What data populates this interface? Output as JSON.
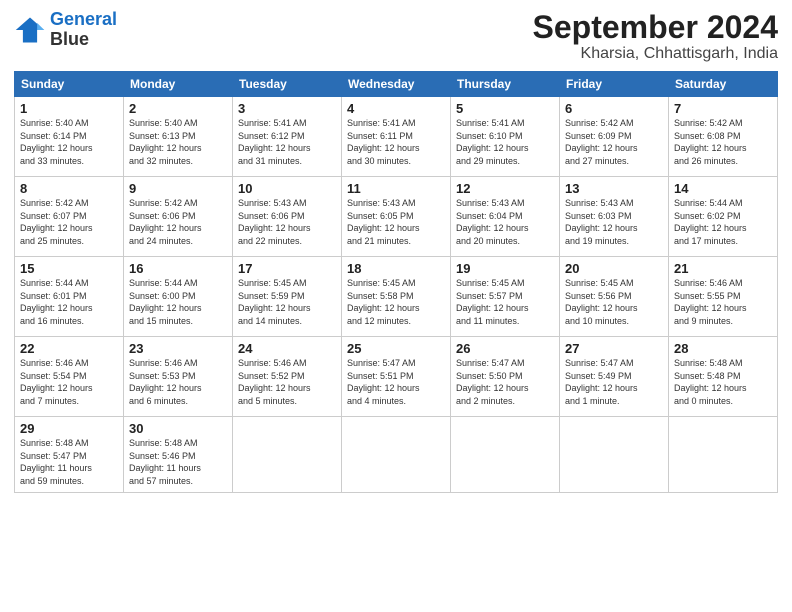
{
  "logo": {
    "line1": "General",
    "line2": "Blue"
  },
  "title": "September 2024",
  "subtitle": "Kharsia, Chhattisgarh, India",
  "weekdays": [
    "Sunday",
    "Monday",
    "Tuesday",
    "Wednesday",
    "Thursday",
    "Friday",
    "Saturday"
  ],
  "weeks": [
    [
      {
        "day": "1",
        "sunrise": "5:40 AM",
        "sunset": "6:14 PM",
        "daylight": "12 hours and 33 minutes."
      },
      {
        "day": "2",
        "sunrise": "5:40 AM",
        "sunset": "6:13 PM",
        "daylight": "12 hours and 32 minutes."
      },
      {
        "day": "3",
        "sunrise": "5:41 AM",
        "sunset": "6:12 PM",
        "daylight": "12 hours and 31 minutes."
      },
      {
        "day": "4",
        "sunrise": "5:41 AM",
        "sunset": "6:11 PM",
        "daylight": "12 hours and 30 minutes."
      },
      {
        "day": "5",
        "sunrise": "5:41 AM",
        "sunset": "6:10 PM",
        "daylight": "12 hours and 29 minutes."
      },
      {
        "day": "6",
        "sunrise": "5:42 AM",
        "sunset": "6:09 PM",
        "daylight": "12 hours and 27 minutes."
      },
      {
        "day": "7",
        "sunrise": "5:42 AM",
        "sunset": "6:08 PM",
        "daylight": "12 hours and 26 minutes."
      }
    ],
    [
      {
        "day": "8",
        "sunrise": "5:42 AM",
        "sunset": "6:07 PM",
        "daylight": "12 hours and 25 minutes."
      },
      {
        "day": "9",
        "sunrise": "5:42 AM",
        "sunset": "6:06 PM",
        "daylight": "12 hours and 24 minutes."
      },
      {
        "day": "10",
        "sunrise": "5:43 AM",
        "sunset": "6:06 PM",
        "daylight": "12 hours and 22 minutes."
      },
      {
        "day": "11",
        "sunrise": "5:43 AM",
        "sunset": "6:05 PM",
        "daylight": "12 hours and 21 minutes."
      },
      {
        "day": "12",
        "sunrise": "5:43 AM",
        "sunset": "6:04 PM",
        "daylight": "12 hours and 20 minutes."
      },
      {
        "day": "13",
        "sunrise": "5:43 AM",
        "sunset": "6:03 PM",
        "daylight": "12 hours and 19 minutes."
      },
      {
        "day": "14",
        "sunrise": "5:44 AM",
        "sunset": "6:02 PM",
        "daylight": "12 hours and 17 minutes."
      }
    ],
    [
      {
        "day": "15",
        "sunrise": "5:44 AM",
        "sunset": "6:01 PM",
        "daylight": "12 hours and 16 minutes."
      },
      {
        "day": "16",
        "sunrise": "5:44 AM",
        "sunset": "6:00 PM",
        "daylight": "12 hours and 15 minutes."
      },
      {
        "day": "17",
        "sunrise": "5:45 AM",
        "sunset": "5:59 PM",
        "daylight": "12 hours and 14 minutes."
      },
      {
        "day": "18",
        "sunrise": "5:45 AM",
        "sunset": "5:58 PM",
        "daylight": "12 hours and 12 minutes."
      },
      {
        "day": "19",
        "sunrise": "5:45 AM",
        "sunset": "5:57 PM",
        "daylight": "12 hours and 11 minutes."
      },
      {
        "day": "20",
        "sunrise": "5:45 AM",
        "sunset": "5:56 PM",
        "daylight": "12 hours and 10 minutes."
      },
      {
        "day": "21",
        "sunrise": "5:46 AM",
        "sunset": "5:55 PM",
        "daylight": "12 hours and 9 minutes."
      }
    ],
    [
      {
        "day": "22",
        "sunrise": "5:46 AM",
        "sunset": "5:54 PM",
        "daylight": "12 hours and 7 minutes."
      },
      {
        "day": "23",
        "sunrise": "5:46 AM",
        "sunset": "5:53 PM",
        "daylight": "12 hours and 6 minutes."
      },
      {
        "day": "24",
        "sunrise": "5:46 AM",
        "sunset": "5:52 PM",
        "daylight": "12 hours and 5 minutes."
      },
      {
        "day": "25",
        "sunrise": "5:47 AM",
        "sunset": "5:51 PM",
        "daylight": "12 hours and 4 minutes."
      },
      {
        "day": "26",
        "sunrise": "5:47 AM",
        "sunset": "5:50 PM",
        "daylight": "12 hours and 2 minutes."
      },
      {
        "day": "27",
        "sunrise": "5:47 AM",
        "sunset": "5:49 PM",
        "daylight": "12 hours and 1 minute."
      },
      {
        "day": "28",
        "sunrise": "5:48 AM",
        "sunset": "5:48 PM",
        "daylight": "12 hours and 0 minutes."
      }
    ],
    [
      {
        "day": "29",
        "sunrise": "5:48 AM",
        "sunset": "5:47 PM",
        "daylight": "11 hours and 59 minutes."
      },
      {
        "day": "30",
        "sunrise": "5:48 AM",
        "sunset": "5:46 PM",
        "daylight": "11 hours and 57 minutes."
      },
      null,
      null,
      null,
      null,
      null
    ]
  ]
}
